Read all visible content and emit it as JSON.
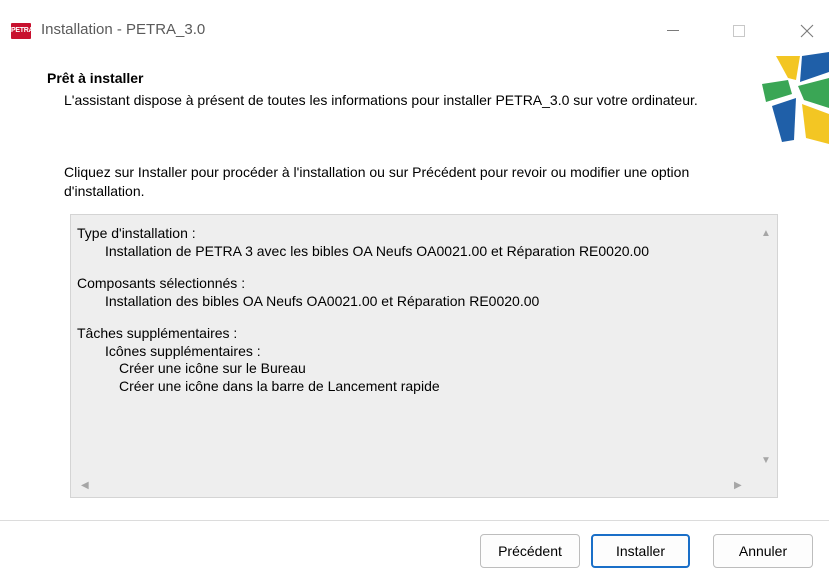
{
  "window": {
    "title": "Installation - PETRA_3.0",
    "app_icon_label": "PETRA"
  },
  "header": {
    "title": "Prêt à installer",
    "description": "L'assistant dispose à présent de toutes les informations pour installer PETRA_3.0 sur votre ordinateur."
  },
  "body": {
    "instruction": "Cliquez sur Installer pour procéder à l'installation ou sur Précédent pour revoir ou modifier une option d'installation."
  },
  "summary": {
    "install_type_label": "Type d'installation :",
    "install_type_value": "Installation de PETRA 3 avec les bibles OA Neufs OA0021.00 et Réparation RE0020.00",
    "components_label": "Composants sélectionnés :",
    "components_value": "Installation des bibles OA Neufs OA0021.00 et Réparation RE0020.00",
    "tasks_label": "Tâches supplémentaires :",
    "tasks_group": "Icônes supplémentaires :",
    "task_desktop": "Créer une icône sur le Bureau",
    "task_quicklaunch": "Créer une icône dans la barre de Lancement rapide"
  },
  "buttons": {
    "previous": "Précédent",
    "install": "Installer",
    "cancel": "Annuler"
  },
  "colors": {
    "accent": "#1a6fc8",
    "summary_bg": "#eeeeee",
    "icon_red": "#c8102e"
  }
}
